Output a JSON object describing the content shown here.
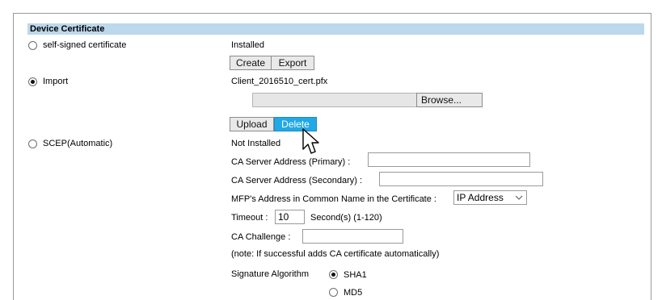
{
  "section_title": "Device Certificate",
  "options": {
    "self_signed": {
      "label": "self-signed certificate",
      "selected": false
    },
    "import": {
      "label": "Import",
      "selected": true
    },
    "scep": {
      "label": "SCEP(Automatic)",
      "selected": false
    }
  },
  "self_signed_status": "Installed",
  "buttons": {
    "create": "Create",
    "export": "Export",
    "browse": "Browse...",
    "upload": "Upload",
    "delete": "Delete"
  },
  "import_filename": "Client_2016510_cert.pfx",
  "scep": {
    "status": "Not Installed",
    "ca_primary_label": "CA Server Address (Primary) :",
    "ca_primary_value": "",
    "ca_secondary_label": "CA Server Address (Secondary) :",
    "ca_secondary_value": "",
    "common_name_label": "MFP's Address in Common Name in the Certificate :",
    "common_name_selected": "IP Address",
    "timeout_label": "Timeout :",
    "timeout_value": "10",
    "timeout_unit": "Second(s) (1-120)",
    "challenge_label": "CA Challenge :",
    "challenge_value": "",
    "note": "(note: If successful adds CA certificate automatically)",
    "sig_alg_label": "Signature Algorithm",
    "sig_options": [
      {
        "label": "SHA1",
        "selected": true
      },
      {
        "label": "MD5",
        "selected": false
      }
    ]
  },
  "icons": {
    "cursor": "mouse-pointer-icon",
    "dropdown": "chevron-down-icon"
  }
}
